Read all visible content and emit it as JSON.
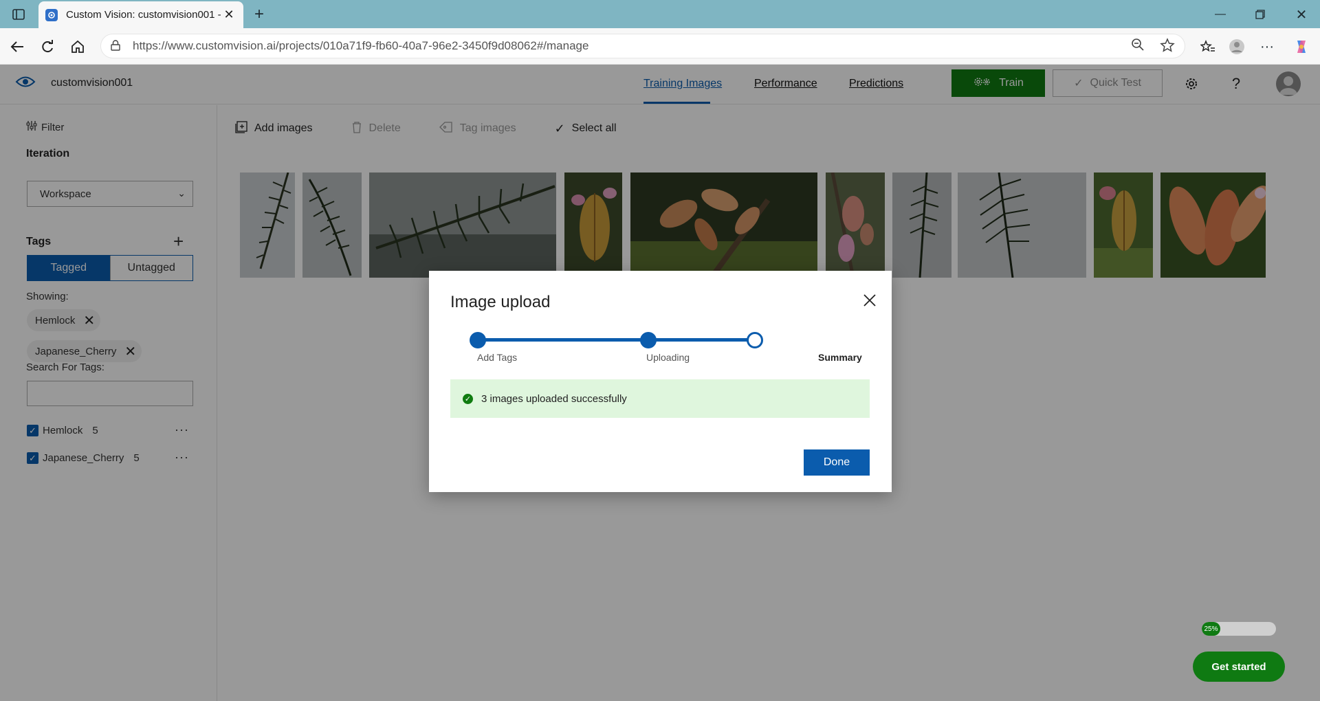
{
  "browser": {
    "tab_title": "Custom Vision: customvision001 - ",
    "url_host": "https://www.customvision.ai",
    "url_path": "/projects/010a71f9-fb60-40a7-96e2-3450f9d08062#/manage"
  },
  "header": {
    "project_name": "customvision001",
    "nav": {
      "training_images": "Training Images",
      "performance": "Performance",
      "predictions": "Predictions"
    },
    "train_label": "Train",
    "quick_test_label": "Quick Test"
  },
  "sidebar": {
    "filter_label": "Filter",
    "iteration_label": "Iteration",
    "iteration_value": "Workspace",
    "tags_label": "Tags",
    "segment": {
      "tagged": "Tagged",
      "untagged": "Untagged"
    },
    "showing_label": "Showing:",
    "chips": [
      "Hemlock",
      "Japanese_Cherry"
    ],
    "search_label": "Search For Tags:",
    "tag_list": [
      {
        "name": "Hemlock",
        "count": "5"
      },
      {
        "name": "Japanese_Cherry",
        "count": "5"
      }
    ]
  },
  "toolbar": {
    "add_images": "Add images",
    "delete": "Delete",
    "tag_images": "Tag images",
    "select_all": "Select all"
  },
  "modal": {
    "title": "Image upload",
    "steps": [
      "Add Tags",
      "Uploading",
      "Summary"
    ],
    "success_message": "3 images uploaded successfully",
    "done_label": "Done"
  },
  "onboarding": {
    "progress_percent": 25,
    "progress_label": "25%",
    "get_started_label": "Get started"
  },
  "colors": {
    "accent_blue": "#0b5cad",
    "train_green": "#0f7a12",
    "success_bg": "#dff6dd"
  }
}
